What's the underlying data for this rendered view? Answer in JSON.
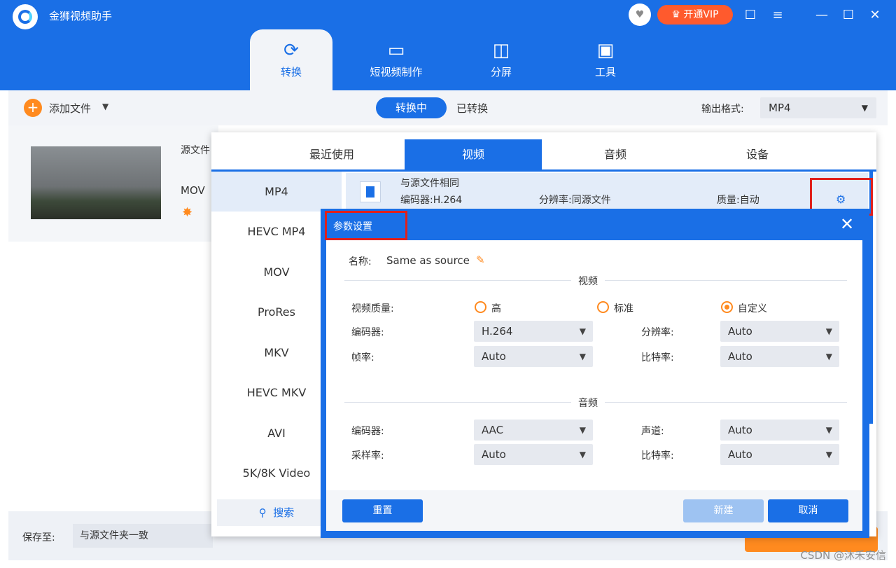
{
  "app": {
    "title": "金狮视频助手",
    "vip_label": "开通VIP",
    "heart_icon": "heart-icon",
    "chat_icon": "chat-icon",
    "menu_icon": "menu-icon",
    "minimize_icon": "minimize-icon",
    "maximize_icon": "maximize-icon",
    "close_icon": "close-icon"
  },
  "main_tabs": [
    {
      "label": "转换",
      "icon": "convert-icon",
      "active": true
    },
    {
      "label": "短视频制作",
      "icon": "tv-icon",
      "active": false
    },
    {
      "label": "分屏",
      "icon": "split-screen-icon",
      "active": false
    },
    {
      "label": "工具",
      "icon": "toolbox-icon",
      "active": false
    }
  ],
  "toolbar": {
    "add_file": "添加文件",
    "converting": "转换中",
    "converted": "已转换",
    "output_format_label": "输出格式:",
    "output_format_value": "MP4"
  },
  "file": {
    "source_label": "源文件",
    "format": "MOV"
  },
  "bottom": {
    "save_to_label": "保存至:",
    "save_to_value": "与源文件夹一致"
  },
  "format_panel": {
    "tabs": [
      "最近使用",
      "视频",
      "音频",
      "设备"
    ],
    "active_tab": "视频",
    "formats": [
      "MP4",
      "HEVC MP4",
      "MOV",
      "ProRes",
      "MKV",
      "HEVC MKV",
      "AVI",
      "5K/8K Video"
    ],
    "active_format": "MP4",
    "search_label": "搜索",
    "preset": {
      "name": "与源文件相同",
      "encoder": "编码器:H.264",
      "resolution": "分辨率:同源文件",
      "quality": "质量:自动"
    }
  },
  "dialog": {
    "title": "参数设置",
    "name_label": "名称:",
    "name_value": "Same as source",
    "video_section": "视频",
    "video_quality_label": "视频质量:",
    "quality_options": [
      {
        "label": "高",
        "checked": false
      },
      {
        "label": "标准",
        "checked": false
      },
      {
        "label": "自定义",
        "checked": true
      }
    ],
    "video_encoder_label": "编码器:",
    "video_encoder_value": "H.264",
    "resolution_label": "分辨率:",
    "resolution_value": "Auto",
    "framerate_label": "帧率:",
    "framerate_value": "Auto",
    "video_bitrate_label": "比特率:",
    "video_bitrate_value": "Auto",
    "audio_section": "音频",
    "audio_encoder_label": "编码器:",
    "audio_encoder_value": "AAC",
    "channel_label": "声道:",
    "channel_value": "Auto",
    "samplerate_label": "采样率:",
    "samplerate_value": "Auto",
    "audio_bitrate_label": "比特率:",
    "audio_bitrate_value": "Auto",
    "reset_label": "重置",
    "new_label": "新建",
    "cancel_label": "取消"
  },
  "watermark": "CSDN @沐禾安信",
  "colors": {
    "brand_blue": "#1a6fe6",
    "accent_orange": "#ff8a1f",
    "highlight_red": "#e0201c"
  }
}
